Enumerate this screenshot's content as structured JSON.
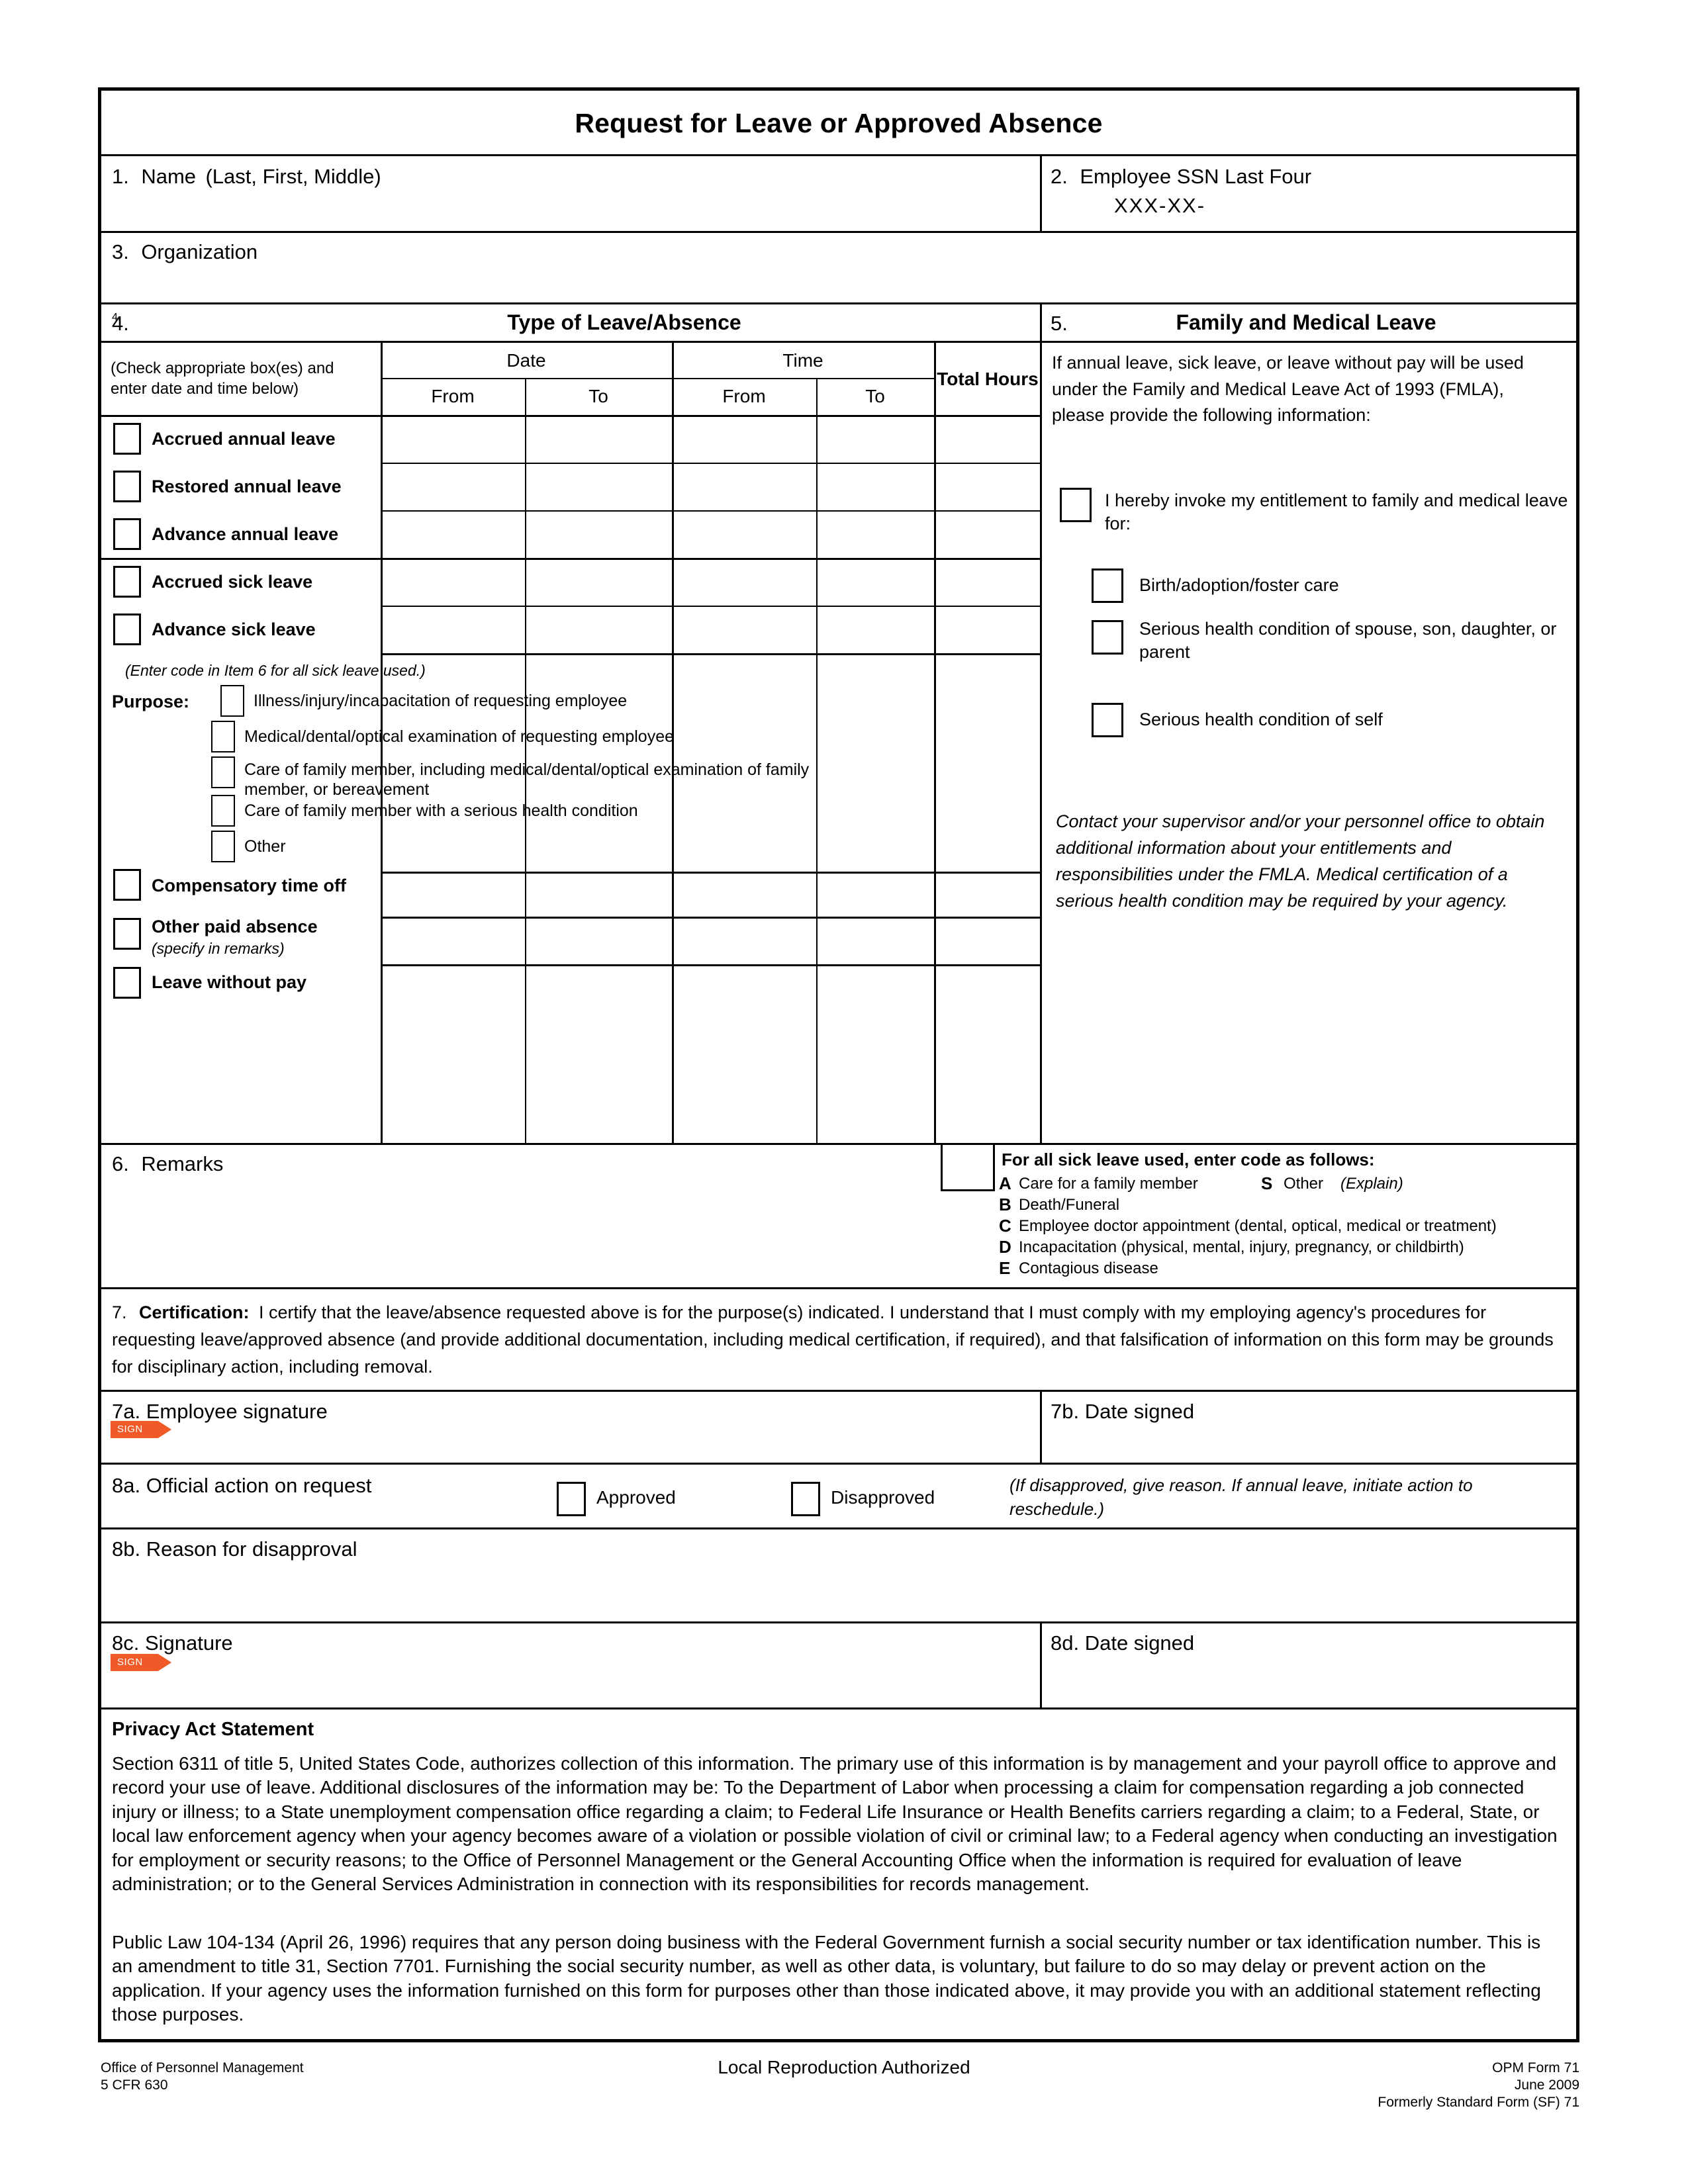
{
  "form": {
    "title": "Request for Leave or Approved Absence"
  },
  "item1": {
    "number": "1.",
    "label": "Name",
    "hint": "(Last, First, Middle)"
  },
  "item2": {
    "number": "2.",
    "label": "Employee SSN Last Four",
    "mask": "XXX-XX-"
  },
  "item3": {
    "number": "3.",
    "label": "Organization"
  },
  "item4": {
    "number": "4.",
    "heading": "Type of Leave/Absence",
    "instruction": "(Check appropriate box(es) and enter date and time below)",
    "columns": {
      "date": "Date",
      "time": "Time",
      "date_from": "From",
      "date_to": "To",
      "time_from": "From",
      "time_to": "To",
      "total_hours": "Total Hours"
    },
    "leave_rows": [
      {
        "label": "Accrued annual leave"
      },
      {
        "label": "Restored annual leave"
      },
      {
        "label": "Advance annual leave"
      },
      {
        "label": "Accrued sick leave"
      },
      {
        "label": "Advance sick leave"
      }
    ],
    "sick_note": "(Enter code in Item 6 for all sick leave used.)",
    "purpose_label": "Purpose:",
    "purpose_options": [
      "Illness/injury/incapacitation of requesting employee",
      "Medical/dental/optical examination of requesting employee",
      "Care of family member, including medical/dental/optical examination of family member, or bereavement",
      "Care of family member with a serious health condition",
      "Other"
    ],
    "bottom_rows": [
      {
        "label": "Compensatory time off",
        "sub": ""
      },
      {
        "label": "Other paid absence",
        "sub": "(specify in remarks)"
      },
      {
        "label": "Leave without pay",
        "sub": ""
      }
    ]
  },
  "item5": {
    "number": "5.",
    "heading": "Family and Medical Leave",
    "body": "If annual leave, sick leave, or leave without pay will be used under the Family and Medical Leave Act of 1993 (FMLA), please provide the following information:",
    "invoke_label": "I hereby invoke my entitlement to family and medical leave for:",
    "reasons": [
      "Birth/adoption/foster care",
      "Serious health condition of spouse, son, daughter, or parent",
      "Serious health condition of self"
    ],
    "note": "Contact your supervisor and/or your personnel office to obtain additional information about your entitlements and responsibilities under the FMLA.  Medical certification of a serious health condition may be required by your agency."
  },
  "item6": {
    "number": "6.",
    "label": "Remarks",
    "codes_heading": "For all sick leave used, enter code as follows:",
    "codes": [
      {
        "letter": "A",
        "text": "Care for a family member"
      },
      {
        "letter": "B",
        "text": "Death/Funeral"
      },
      {
        "letter": "C",
        "text": "Employee  doctor appointment (dental, optical, medical or treatment)"
      },
      {
        "letter": "D",
        "text": "Incapacitation (physical, mental, injury, pregnancy, or childbirth)"
      },
      {
        "letter": "E",
        "text": "Contagious disease"
      }
    ],
    "code_s": {
      "letter": "S",
      "text": "Other ",
      "hint": "(Explain)"
    }
  },
  "item7": {
    "number": "7.",
    "label": "Certification:",
    "text": "I certify that the leave/absence requested above is for the purpose(s) indicated.  I understand that I must comply with my employing agency's procedures for requesting leave/approved absence (and provide additional  documentation, including medical certification, if required), and that falsification of information on this form may be grounds for disciplinary action, including removal.",
    "a_label": "7a. Employee signature",
    "b_label": "7b. Date signed",
    "sign_tag": "SIGN"
  },
  "item8": {
    "a_label": "8a. Official action on request",
    "approved": "Approved",
    "disapproved": "Disapproved",
    "note": "(If disapproved, give reason.  If annual leave, initiate action to reschedule.)",
    "b_label": "8b. Reason for disapproval",
    "c_label": "8c. Signature",
    "d_label": "8d. Date signed",
    "sign_tag": "SIGN"
  },
  "privacy": {
    "heading": "Privacy Act Statement",
    "paragraph1": "Section 6311 of title 5, United States Code, authorizes collection of this information. The primary use of this information is by management and your payroll office to approve and record your use of leave.  Additional disclosures of the information may be:  To the Department of Labor when processing a claim for compensation regarding a job connected injury or illness; to a State unemployment compensation office regarding a claim; to Federal Life Insurance or Health Benefits carriers regarding a claim; to a Federal, State, or local law enforcement agency when your agency becomes aware of a violation or possible violation of civil or criminal law; to a Federal agency when conducting an investigation for employment or security reasons; to the Office of Personnel Management or the General Accounting Office when the information is required for evaluation of leave administration; or to the General Services Administration in connection with its responsibilities for records management.",
    "paragraph2": "Public Law 104-134 (April 26, 1996) requires that any person doing business with the Federal Government furnish a social security number or tax identification number.  This is an amendment to title 31, Section 7701.  Furnishing the social security number, as well as other data, is voluntary, but failure to do so may delay or prevent action on the application.  If your agency uses the information furnished on this form for purposes other than those indicated above, it may provide you with an additional statement reflecting those purposes."
  },
  "footer": {
    "left_line1": "Office of Personnel Management",
    "left_line2": "5 CFR 630",
    "center": "Local Reproduction Authorized",
    "right_line1": "OPM Form 71",
    "right_line2": "June 2009",
    "right_line3": "Formerly Standard Form (SF) 71"
  },
  "colors": {
    "sign_tag": "#ef5a28",
    "rule": "#000000"
  }
}
